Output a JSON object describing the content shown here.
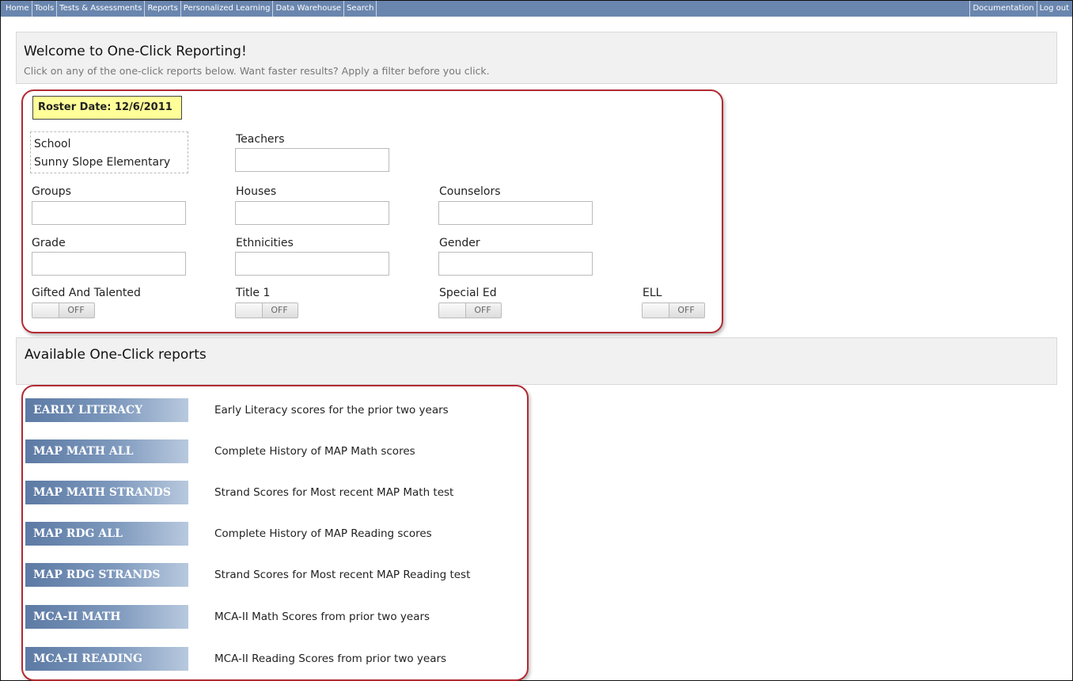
{
  "nav": {
    "left": [
      "Home",
      "Tools",
      "Tests & Assessments",
      "Reports",
      "Personalized Learning",
      "Data Warehouse",
      "Search"
    ],
    "right": [
      "Documentation",
      "Log out"
    ]
  },
  "welcome": {
    "title": "Welcome to One-Click Reporting!",
    "subtitle": "Click on any of the one-click reports below. Want faster results? Apply a filter before you click."
  },
  "filters": {
    "roster_date": "Roster Date: 12/6/2011",
    "school_label": "School",
    "school_value": "Sunny Slope Elementary",
    "teachers": "Teachers",
    "groups": "Groups",
    "houses": "Houses",
    "counselors": "Counselors",
    "grade": "Grade",
    "ethnicities": "Ethnicities",
    "gender": "Gender",
    "toggles": [
      {
        "label": "Gifted And Talented",
        "state": "OFF"
      },
      {
        "label": "Title 1",
        "state": "OFF"
      },
      {
        "label": "Special Ed",
        "state": "OFF"
      },
      {
        "label": "ELL",
        "state": "OFF"
      }
    ]
  },
  "available_header": "Available One-Click reports",
  "reports": [
    {
      "button": "EARLY LITERACY",
      "desc": "Early Literacy scores for the prior two years"
    },
    {
      "button": "MAP MATH ALL",
      "desc": "Complete History of MAP Math scores"
    },
    {
      "button": "MAP MATH STRANDS",
      "desc": "Strand Scores for Most recent MAP Math test"
    },
    {
      "button": "MAP RDG ALL",
      "desc": "Complete History of MAP Reading scores"
    },
    {
      "button": "MAP RDG STRANDS",
      "desc": "Strand Scores for Most recent MAP Reading test"
    },
    {
      "button": "MCA-II MATH",
      "desc": "MCA-II Math Scores from prior two years"
    },
    {
      "button": "MCA-II READING",
      "desc": "MCA-II Reading Scores from prior two years"
    }
  ]
}
